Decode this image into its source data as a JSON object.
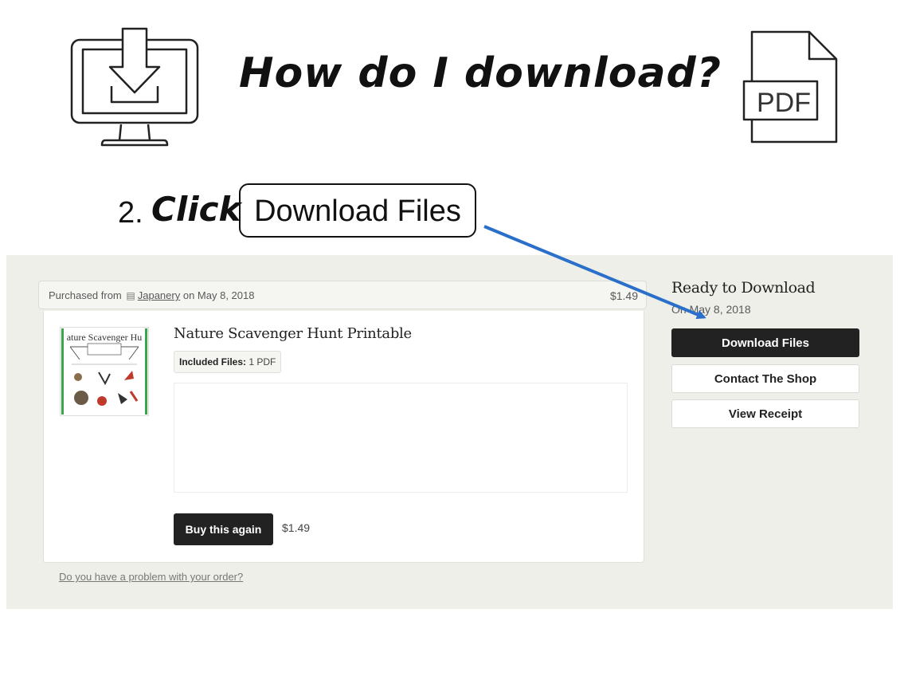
{
  "banner": {
    "title": "How do I download?",
    "pdf_icon_label": "PDF",
    "step_number": "2.",
    "step_verb": "Click",
    "step_target": "Download Files"
  },
  "order": {
    "purchased_prefix": "Purchased from",
    "shop_name": "Japanery",
    "purchased_suffix": "on May 8, 2018",
    "header_price": "$1.49",
    "product_title": "Nature Scavenger Hunt Printable",
    "thumbnail_caption": "ature Scavenger Hu",
    "included_files_label": "Included Files:",
    "included_files_value": "1 PDF",
    "buy_again_label": "Buy this again",
    "buy_again_price": "$1.49",
    "problem_link": "Do you have a problem with your order?"
  },
  "sidebar": {
    "ready_title": "Ready to Download",
    "ready_date": "On May 8, 2018",
    "download_button": "Download Files",
    "contact_button": "Contact The Shop",
    "receipt_button": "View Receipt"
  },
  "icons": [
    "monitor-download-icon",
    "pdf-file-icon",
    "shop-icon",
    "arrow-pointer"
  ],
  "colors": {
    "arrow": "#2a6fc9",
    "dark_button": "#222222",
    "panel_bg": "#efefea"
  }
}
